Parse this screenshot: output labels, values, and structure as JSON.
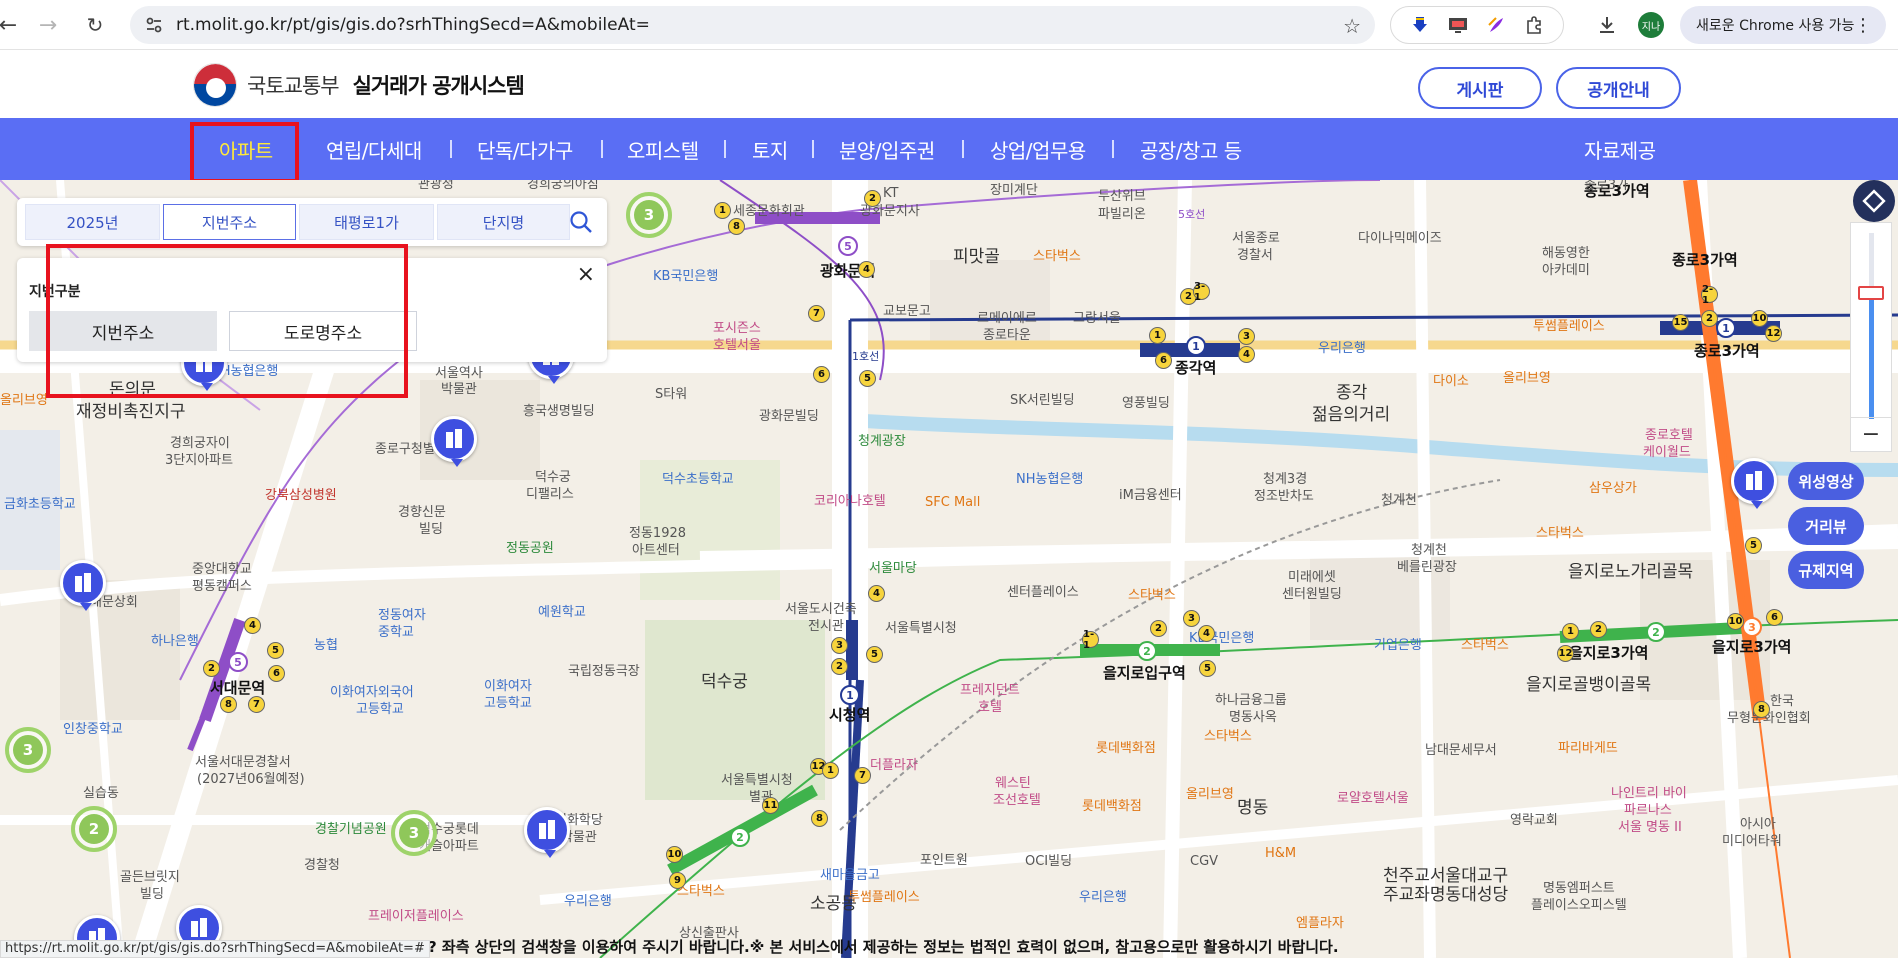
{
  "browser": {
    "url": "rt.molit.go.kr/pt/gis/gis.do?srhThingSecd=A&mobileAt=",
    "profile_initials": "지나",
    "update_label": "새로운 Chrome 사용 가능"
  },
  "header": {
    "ministry": "국토교통부",
    "system_name": "실거래가 공개시스템",
    "board_button": "게시판",
    "notice_button": "공개안내"
  },
  "nav": {
    "items": [
      "아파트",
      "연립/다세대",
      "단독/다가구",
      "오피스텔",
      "토지",
      "분양/입주권",
      "상업/업무용",
      "공장/창고 등"
    ],
    "separator": "|",
    "data_service": "자료제공"
  },
  "search": {
    "tabs": [
      "2025년",
      "지번주소",
      "태평로1가",
      "단지명"
    ]
  },
  "address_panel": {
    "title": "지번구분",
    "options": [
      "지번주소",
      "도로명주소"
    ],
    "close": "×"
  },
  "map_buttons": [
    "위성영상",
    "거리뷰",
    "규제지역"
  ],
  "map": {
    "labels": [
      {
        "t": "관광청",
        "c": "poi"
      },
      {
        "t": "경희궁의아침",
        "c": "poi"
      },
      {
        "t": "세종문화회관",
        "c": "poi"
      },
      {
        "t": "KT",
        "c": "poi"
      },
      {
        "t": "광화문지사",
        "c": "poi"
      },
      {
        "t": "장미계단",
        "c": "poi"
      },
      {
        "t": "두산위브",
        "c": "poi"
      },
      {
        "t": "파빌리온",
        "c": "poi"
      },
      {
        "t": "서울종로",
        "c": "poi"
      },
      {
        "t": "경찰서",
        "c": "poi"
      },
      {
        "t": "다이나믹메이즈",
        "c": "poi"
      },
      {
        "t": "해동영한",
        "c": "poi"
      },
      {
        "t": "아카데미",
        "c": "poi"
      },
      {
        "t": "종로3가역",
        "c": "station"
      },
      {
        "t": "종로3가역",
        "c": "station"
      },
      {
        "t": "종로3가역",
        "c": "station"
      },
      {
        "t": "광화문역",
        "c": "station"
      },
      {
        "t": "피맛골",
        "c": "big"
      },
      {
        "t": "스타벅스",
        "c": "orange"
      },
      {
        "t": "KB국민은행",
        "c": "blue"
      },
      {
        "t": "교보문고",
        "c": "poi"
      },
      {
        "t": "르메이에르",
        "c": "poi"
      },
      {
        "t": "종로타운",
        "c": "poi"
      },
      {
        "t": "그랑서울",
        "c": "poi"
      },
      {
        "t": "포시즌스",
        "c": "pink"
      },
      {
        "t": "호텔서울",
        "c": "pink"
      },
      {
        "t": "종각역",
        "c": "station"
      },
      {
        "t": "우리은행",
        "c": "blue"
      },
      {
        "t": "투썸플레이스",
        "c": "orange"
      },
      {
        "t": "다이소",
        "c": "orange"
      },
      {
        "t": "올리브영",
        "c": "orange"
      },
      {
        "t": "NH농협은행",
        "c": "blue"
      },
      {
        "t": "S타워",
        "c": "poi"
      },
      {
        "t": "광화문빌딩",
        "c": "poi"
      },
      {
        "t": "SK서린빌딩",
        "c": "poi"
      },
      {
        "t": "영풍빌딩",
        "c": "poi"
      },
      {
        "t": "종각",
        "c": "big"
      },
      {
        "t": "젊음의거리",
        "c": "big"
      },
      {
        "t": "돈의문",
        "c": "big"
      },
      {
        "t": "재정비촉진지구",
        "c": "big"
      },
      {
        "t": "서울역사",
        "c": "poi"
      },
      {
        "t": "박물관",
        "c": "poi"
      },
      {
        "t": "흥국생명빌딩",
        "c": "poi"
      },
      {
        "t": "종로구청별관",
        "c": "poi"
      },
      {
        "t": "청계광장",
        "c": "green"
      },
      {
        "t": "종로호텔",
        "c": "pink"
      },
      {
        "t": "케이월드",
        "c": "pink"
      },
      {
        "t": "올리브영",
        "c": "orange"
      },
      {
        "t": "경희궁자이",
        "c": "poi"
      },
      {
        "t": "3단지아파트",
        "c": "poi"
      },
      {
        "t": "강북삼성병원",
        "c": "red"
      },
      {
        "t": "덕수궁",
        "c": "poi"
      },
      {
        "t": "디팰리스",
        "c": "poi"
      },
      {
        "t": "덕수초등학교",
        "c": "blue"
      },
      {
        "t": "코리아나호텔",
        "c": "pink"
      },
      {
        "t": "SFC Mall",
        "c": "orange"
      },
      {
        "t": "NH농협은행",
        "c": "blue"
      },
      {
        "t": "iM금융센터",
        "c": "poi"
      },
      {
        "t": "청계3경",
        "c": "poi"
      },
      {
        "t": "정조반차도",
        "c": "poi"
      },
      {
        "t": "청계천",
        "c": "poi"
      },
      {
        "t": "삼우상가",
        "c": "orange"
      },
      {
        "t": "금화초등학교",
        "c": "blue"
      },
      {
        "t": "경향신문",
        "c": "poi"
      },
      {
        "t": "빌딩",
        "c": "poi"
      },
      {
        "t": "정동공원",
        "c": "green"
      },
      {
        "t": "정동1928",
        "c": "poi"
      },
      {
        "t": "아트센터",
        "c": "poi"
      },
      {
        "t": "서울마당",
        "c": "green"
      },
      {
        "t": "청계천",
        "c": "poi"
      },
      {
        "t": "베를린광장",
        "c": "poi"
      },
      {
        "t": "스타벅스",
        "c": "orange"
      },
      {
        "t": "중앙대학교",
        "c": "poi"
      },
      {
        "t": "평동캠퍼스",
        "c": "poi"
      },
      {
        "t": "배문상회",
        "c": "poi"
      },
      {
        "t": "정동여자",
        "c": "blue"
      },
      {
        "t": "중학교",
        "c": "blue"
      },
      {
        "t": "예원학교",
        "c": "blue"
      },
      {
        "t": "서울도시건축",
        "c": "poi"
      },
      {
        "t": "전시관",
        "c": "poi"
      },
      {
        "t": "서울특별시청",
        "c": "poi"
      },
      {
        "t": "센터플레이스",
        "c": "poi"
      },
      {
        "t": "스타벅스",
        "c": "orange"
      },
      {
        "t": "미래에셋",
        "c": "poi"
      },
      {
        "t": "센터원빌딩",
        "c": "poi"
      },
      {
        "t": "을지로노가리골목",
        "c": "big"
      },
      {
        "t": "하나은행",
        "c": "blue"
      },
      {
        "t": "농협",
        "c": "blue"
      },
      {
        "t": "KB국민은행",
        "c": "blue"
      },
      {
        "t": "기업은행",
        "c": "blue"
      },
      {
        "t": "스타벅스",
        "c": "orange"
      },
      {
        "t": "서대문역",
        "c": "station"
      },
      {
        "t": "이화여자외국어",
        "c": "blue"
      },
      {
        "t": "고등학교",
        "c": "blue"
      },
      {
        "t": "이화여자",
        "c": "blue"
      },
      {
        "t": "고등학교",
        "c": "blue"
      },
      {
        "t": "국립정동극장",
        "c": "poi"
      },
      {
        "t": "덕수궁",
        "c": "big"
      },
      {
        "t": "을지로입구역",
        "c": "station"
      },
      {
        "t": "을지로3가역",
        "c": "station"
      },
      {
        "t": "을지로3가역",
        "c": "station"
      },
      {
        "t": "인창중학교",
        "c": "blue"
      },
      {
        "t": "서울서대문경찰서",
        "c": "poi"
      },
      {
        "t": "(2027년06월예정)",
        "c": "poi"
      },
      {
        "t": "시청역",
        "c": "station"
      },
      {
        "t": "프레지던트",
        "c": "pink"
      },
      {
        "t": "호텔",
        "c": "pink"
      },
      {
        "t": "하나금융그룹",
        "c": "poi"
      },
      {
        "t": "명동사옥",
        "c": "poi"
      },
      {
        "t": "을지로골뱅이골목",
        "c": "big"
      },
      {
        "t": "한국",
        "c": "poi"
      },
      {
        "t": "무형문화인협회",
        "c": "poi"
      },
      {
        "t": "실습동",
        "c": "poi"
      },
      {
        "t": "서울특별시청",
        "c": "poi"
      },
      {
        "t": "별관",
        "c": "poi"
      },
      {
        "t": "더플라자",
        "c": "pink"
      },
      {
        "t": "롯데백화점",
        "c": "orange"
      },
      {
        "t": "스타벅스",
        "c": "orange"
      },
      {
        "t": "남대문세무서",
        "c": "poi"
      },
      {
        "t": "파리바게뜨",
        "c": "orange"
      },
      {
        "t": "웨스틴",
        "c": "pink"
      },
      {
        "t": "조선호텔",
        "c": "pink"
      },
      {
        "t": "롯데백화점",
        "c": "orange"
      },
      {
        "t": "올리브영",
        "c": "orange"
      },
      {
        "t": "명동",
        "c": "big"
      },
      {
        "t": "로얄호텔서울",
        "c": "pink"
      },
      {
        "t": "영락교회",
        "c": "poi"
      },
      {
        "t": "나인트리 바이",
        "c": "pink"
      },
      {
        "t": "파르나스",
        "c": "pink"
      },
      {
        "t": "서울 명동 II",
        "c": "pink"
      },
      {
        "t": "아시아",
        "c": "poi"
      },
      {
        "t": "미디어타워",
        "c": "poi"
      },
      {
        "t": "경찰기념공원",
        "c": "green"
      },
      {
        "t": "덕수궁롯데",
        "c": "poi"
      },
      {
        "t": "캐슬아파트",
        "c": "poi"
      },
      {
        "t": "이화학당",
        "c": "poi"
      },
      {
        "t": "사박물관",
        "c": "poi"
      },
      {
        "t": "골든브릿지",
        "c": "poi"
      },
      {
        "t": "빌딩",
        "c": "poi"
      },
      {
        "t": "경찰청",
        "c": "poi"
      },
      {
        "t": "새마을금고",
        "c": "blue"
      },
      {
        "t": "포인트원",
        "c": "poi"
      },
      {
        "t": "OCI빌딩",
        "c": "poi"
      },
      {
        "t": "CGV",
        "c": "poi"
      },
      {
        "t": "H&M",
        "c": "orange"
      },
      {
        "t": "천주교서울대교구",
        "c": "big"
      },
      {
        "t": "주교좌명동대성당",
        "c": "big"
      },
      {
        "t": "명동엠퍼스트",
        "c": "poi"
      },
      {
        "t": "플레이스오피스텔",
        "c": "poi"
      },
      {
        "t": "우리은행",
        "c": "blue"
      },
      {
        "t": "스타벅스",
        "c": "orange"
      },
      {
        "t": "투썸플레이스",
        "c": "orange"
      },
      {
        "t": "소공동",
        "c": "big"
      },
      {
        "t": "우리은행",
        "c": "blue"
      },
      {
        "t": "엠플라자",
        "c": "orange"
      },
      {
        "t": "프레이저플레이스",
        "c": "pink"
      },
      {
        "t": "상신출판사",
        "c": "poi"
      },
      {
        "t": "종로3가",
        "c": "poi"
      },
      {
        "t": "5호선",
        "c": "purple"
      },
      {
        "t": "1호선",
        "c": "navy"
      }
    ]
  },
  "footer": {
    "status_url": "https://rt.molit.go.kr/pt/gis/gis.do?srhThingSecd=A&mobileAt=#",
    "notice": "? 좌측 상단의 검색창을 이용하여 주시기 바랍니다.※ 본 서비스에서 제공하는 정보는 법적인 효력이 없으며, 참고용으로만 활용하시기 바랍니다."
  }
}
